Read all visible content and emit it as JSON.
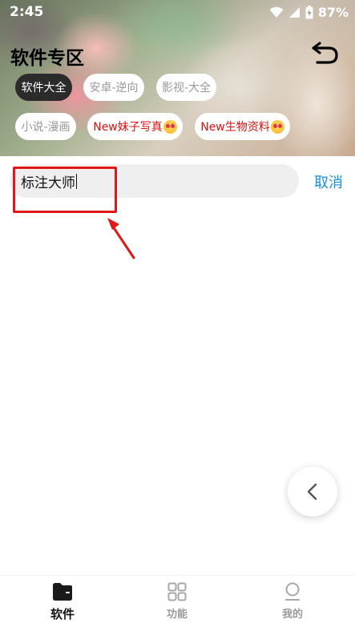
{
  "status_bar": {
    "time": "2:45",
    "battery": "87%",
    "icons": [
      "wifi-icon",
      "signal-icon",
      "battery-icon"
    ]
  },
  "header": {
    "title": "软件专区",
    "back_icon": "undo-arrow-icon"
  },
  "categories": [
    {
      "label": "软件大全",
      "active": true
    },
    {
      "label": "安卓-逆向",
      "active": false
    },
    {
      "label": "影视-大全",
      "active": false
    },
    {
      "label": "小说-漫画",
      "active": false
    },
    {
      "label": "New妹子写真",
      "active": false,
      "emoji": "heart-eyes-emoji"
    },
    {
      "label": "New生物资料",
      "active": false,
      "emoji": "heart-eyes-emoji"
    }
  ],
  "search": {
    "value": "标注大师",
    "cancel_label": "取消"
  },
  "floating_button": {
    "icon": "chevron-left-icon"
  },
  "bottom_nav": [
    {
      "label": "软件",
      "icon": "folder-icon",
      "active": true
    },
    {
      "label": "功能",
      "icon": "grid-icon",
      "active": false
    },
    {
      "label": "我的",
      "icon": "user-icon",
      "active": false
    }
  ],
  "colors": {
    "accent": "#1a8fe0",
    "chip_active_bg": "#2b2b2b",
    "new_text": "#e01010",
    "annotation_red": "#e01818",
    "search_bg": "#efefef"
  }
}
